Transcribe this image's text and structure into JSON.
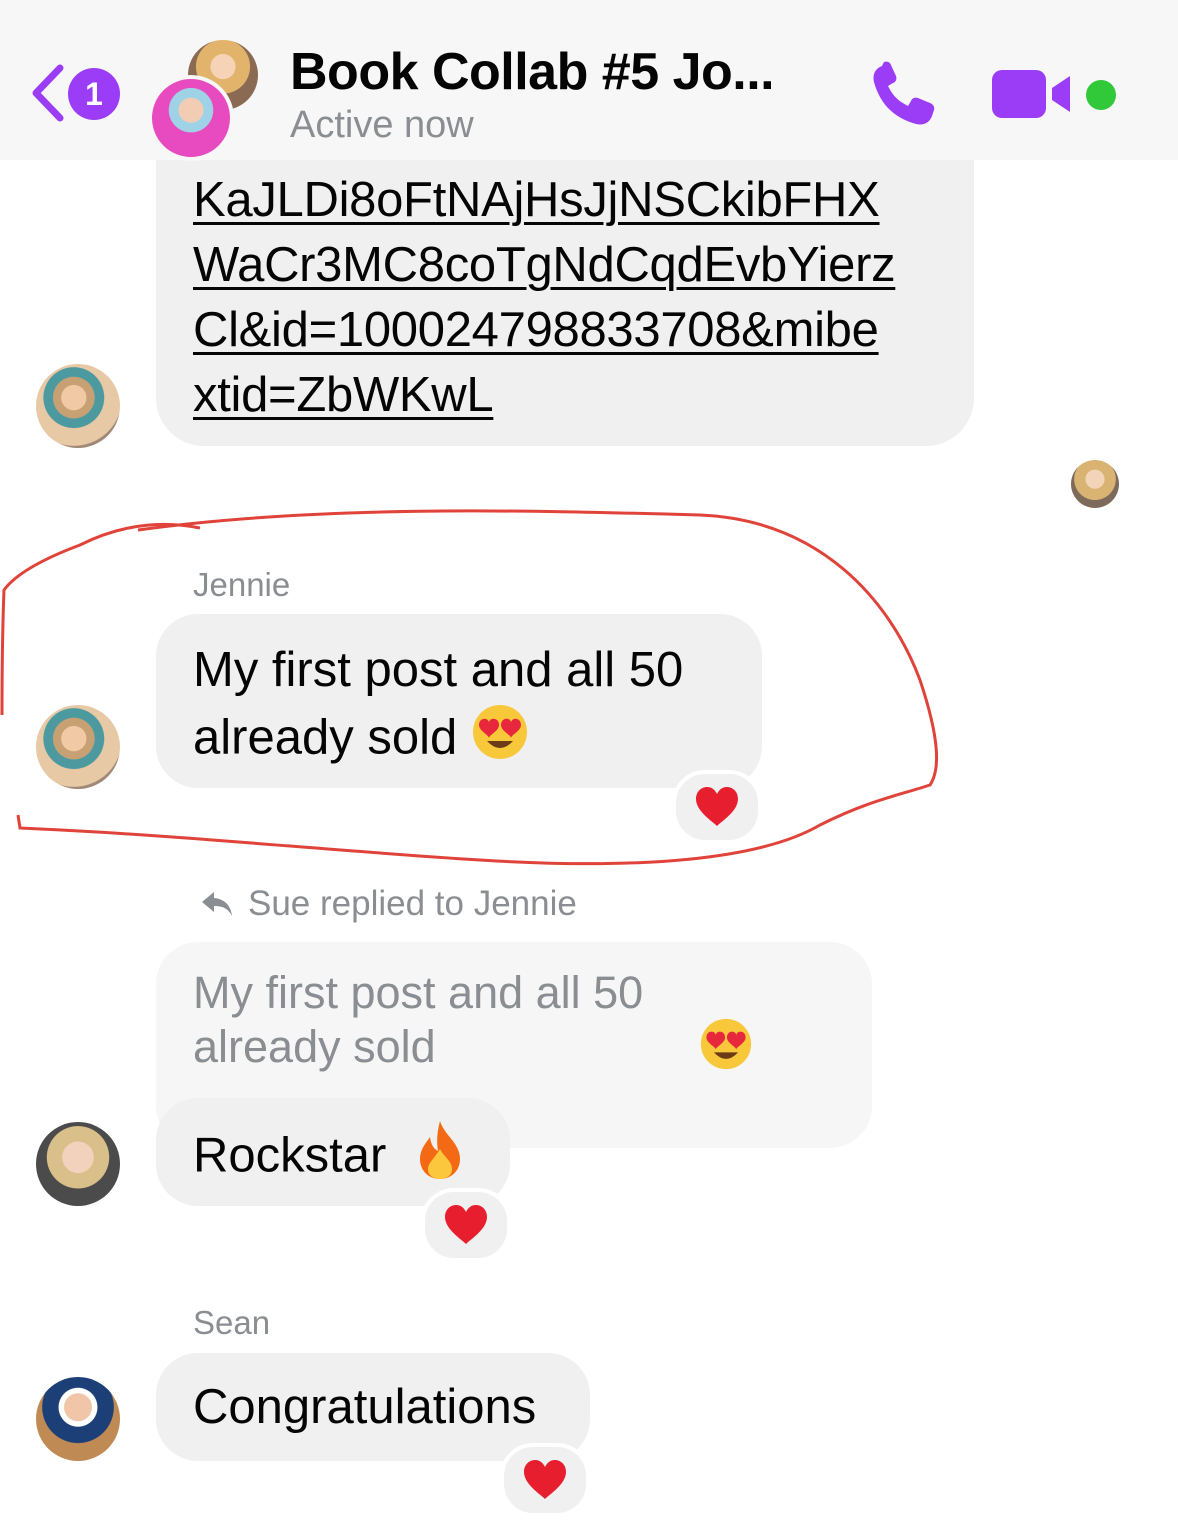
{
  "header": {
    "back_badge": "1",
    "title": "Book Collab #5 Jo...",
    "status": "Active now",
    "icons": [
      "chevron-left-icon",
      "phone-icon",
      "video-camera-icon",
      "online-dot-icon"
    ],
    "accent_color": "#9b3df6",
    "online_color": "#31c93a"
  },
  "messages": {
    "link_message": {
      "text": "KaJLDi8oFtNAjHsJjNSCkibFHX\nWaCr3MC8coTgNdCqdEvbYierz\nCl&id=100024798833708&mibe\nxtid=ZbWKwL"
    },
    "jennie_message": {
      "sender": "Jennie",
      "text": "My first post and all 50 already sold",
      "emoji": "😍",
      "reaction": "❤️"
    },
    "sue_reply": {
      "reply_label": "Sue replied to Jennie",
      "quoted_text": "My first post and all 50 already sold",
      "quoted_emoji": "😍",
      "text": "Rockstar",
      "emoji": "🔥",
      "reaction": "❤️"
    },
    "sean_message": {
      "sender": "Sean",
      "text": "Congratulations",
      "reaction": "❤️"
    }
  },
  "annotation_color": "#e0433a"
}
